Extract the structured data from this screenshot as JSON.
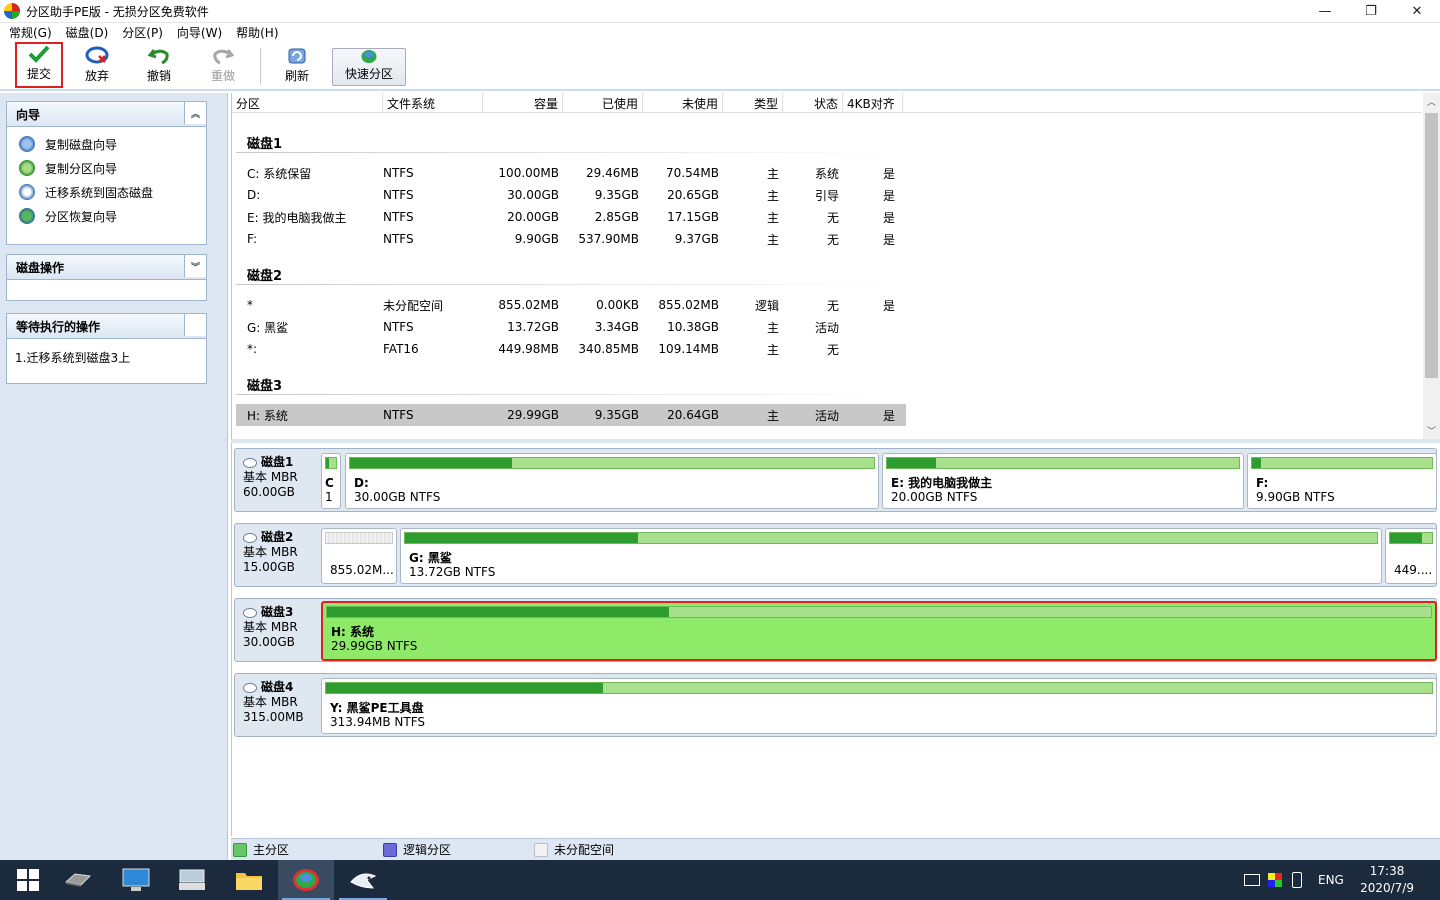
{
  "window": {
    "title": "分区助手PE版 - 无损分区免费软件",
    "minimize": "—",
    "maximize": "❐",
    "close": "✕"
  },
  "menu": [
    "常规(G)",
    "磁盘(D)",
    "分区(P)",
    "向导(W)",
    "帮助(H)"
  ],
  "toolbar": {
    "submit": "提交",
    "discard": "放弃",
    "undo": "撤销",
    "redo": "重做",
    "refresh": "刷新",
    "quick_partition": "快速分区"
  },
  "left_panel": {
    "wizard": {
      "title": "向导",
      "items": [
        "复制磁盘向导",
        "复制分区向导",
        "迁移系统到固态磁盘",
        "分区恢复向导"
      ]
    },
    "disk_ops": {
      "title": "磁盘操作"
    },
    "pending": {
      "title": "等待执行的操作",
      "items": [
        "1.迁移系统到磁盘3上"
      ]
    }
  },
  "table": {
    "columns": [
      "分区",
      "文件系统",
      "容量",
      "已使用",
      "未使用",
      "类型",
      "状态",
      "4KB对齐"
    ],
    "disks": [
      {
        "title": "磁盘1",
        "rows": [
          [
            "C: 系统保留",
            "NTFS",
            "100.00MB",
            "29.46MB",
            "70.54MB",
            "主",
            "系统",
            "是"
          ],
          [
            "D:",
            "NTFS",
            "30.00GB",
            "9.35GB",
            "20.65GB",
            "主",
            "引导",
            "是"
          ],
          [
            "E: 我的电脑我做主",
            "NTFS",
            "20.00GB",
            "2.85GB",
            "17.15GB",
            "主",
            "无",
            "是"
          ],
          [
            "F:",
            "NTFS",
            "9.90GB",
            "537.90MB",
            "9.37GB",
            "主",
            "无",
            "是"
          ]
        ]
      },
      {
        "title": "磁盘2",
        "rows": [
          [
            "*",
            "未分配空间",
            "855.02MB",
            "0.00KB",
            "855.02MB",
            "逻辑",
            "无",
            "是"
          ],
          [
            "G: 黑鲨",
            "NTFS",
            "13.72GB",
            "3.34GB",
            "10.38GB",
            "主",
            "活动",
            ""
          ],
          [
            "*:",
            "FAT16",
            "449.98MB",
            "340.85MB",
            "109.14MB",
            "主",
            "无",
            ""
          ]
        ]
      },
      {
        "title": "磁盘3",
        "rows": [
          [
            "H: 系统",
            "NTFS",
            "29.99GB",
            "9.35GB",
            "20.64GB",
            "主",
            "活动",
            "是"
          ]
        ]
      }
    ]
  },
  "disk_map": [
    {
      "name": "磁盘1",
      "type": "基本 MBR",
      "size": "60.00GB",
      "partitions": [
        {
          "label": "C",
          "info": "1",
          "used": 0.3
        },
        {
          "label": "D:",
          "info": "30.00GB NTFS",
          "used": 0.31
        },
        {
          "label": "E: 我的电脑我做主",
          "info": "20.00GB NTFS",
          "used": 0.14
        },
        {
          "label": "F:",
          "info": "9.90GB NTFS",
          "used": 0.05
        }
      ]
    },
    {
      "name": "磁盘2",
      "type": "基本 MBR",
      "size": "15.00GB",
      "partitions": [
        {
          "label": "",
          "info": "855.02M...",
          "used": 0
        },
        {
          "label": "G: 黑鲨",
          "info": "13.72GB NTFS",
          "used": 0.24
        },
        {
          "label": "",
          "info": "449....",
          "used": 0.76
        }
      ]
    },
    {
      "name": "磁盘3",
      "type": "基本 MBR",
      "size": "30.00GB",
      "partitions": [
        {
          "label": "H: 系统",
          "info": "29.99GB NTFS",
          "used": 0.31
        }
      ]
    },
    {
      "name": "磁盘4",
      "type": "基本 MBR",
      "size": "315.00MB",
      "partitions": [
        {
          "label": "Y: 黑鲨PE工具盘",
          "info": "313.94MB NTFS",
          "used": 0.25
        }
      ]
    }
  ],
  "legend": {
    "primary": "主分区",
    "logical": "逻辑分区",
    "unallocated": "未分配空间"
  },
  "colors": {
    "primary": "#2e9c2e",
    "logical": "#4b4bc8",
    "unallocated": "#f2f2f2",
    "selection": "#e02020"
  },
  "taskbar": {
    "lang": "ENG",
    "time": "17:38",
    "date": "2020/7/9"
  }
}
